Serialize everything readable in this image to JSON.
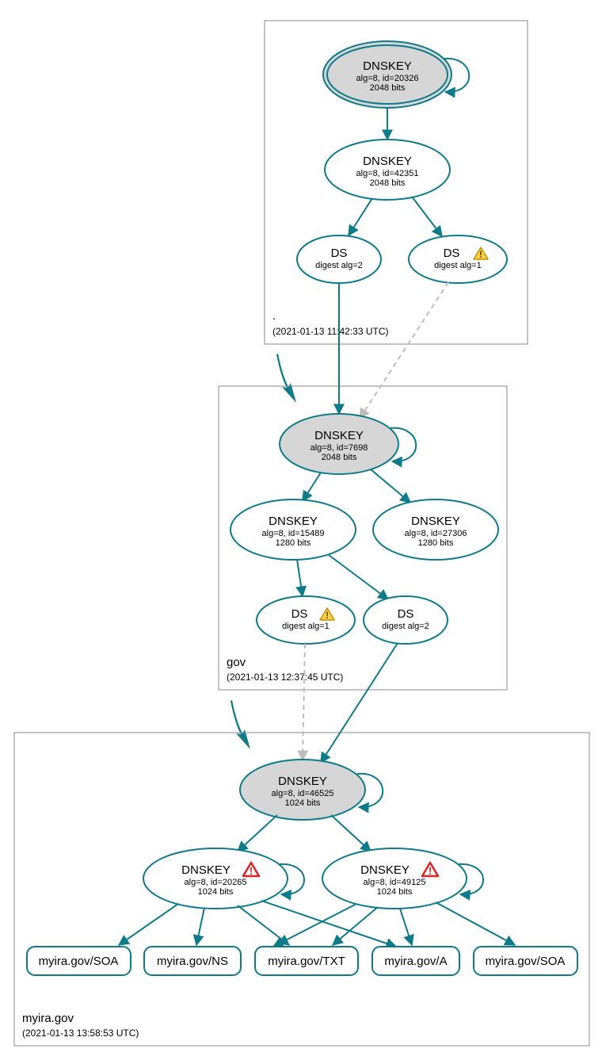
{
  "zones": {
    "root": {
      "label": ".",
      "timestamp": "(2021-01-13 11:42:33 UTC)"
    },
    "gov": {
      "label": "gov",
      "timestamp": "(2021-01-13 12:37:45 UTC)"
    },
    "myira": {
      "label": "myira.gov",
      "timestamp": "(2021-01-13 13:58:53 UTC)"
    }
  },
  "nodes": {
    "root_ksk": {
      "title": "DNSKEY",
      "line1": "alg=8, id=20326",
      "line2": "2048 bits"
    },
    "root_zsk": {
      "title": "DNSKEY",
      "line1": "alg=8, id=42351",
      "line2": "2048 bits"
    },
    "root_ds2": {
      "title": "DS",
      "line1": "digest alg=2"
    },
    "root_ds1": {
      "title": "DS",
      "line1": "digest alg=1"
    },
    "gov_ksk": {
      "title": "DNSKEY",
      "line1": "alg=8, id=7698",
      "line2": "2048 bits"
    },
    "gov_zsk1": {
      "title": "DNSKEY",
      "line1": "alg=8, id=15489",
      "line2": "1280 bits"
    },
    "gov_zsk2": {
      "title": "DNSKEY",
      "line1": "alg=8, id=27306",
      "line2": "1280 bits"
    },
    "gov_ds1": {
      "title": "DS",
      "line1": "digest alg=1"
    },
    "gov_ds2": {
      "title": "DS",
      "line1": "digest alg=2"
    },
    "my_ksk": {
      "title": "DNSKEY",
      "line1": "alg=8, id=46525",
      "line2": "1024 bits"
    },
    "my_zsk1": {
      "title": "DNSKEY",
      "line1": "alg=8, id=20265",
      "line2": "1024 bits"
    },
    "my_zsk2": {
      "title": "DNSKEY",
      "line1": "alg=8, id=49125",
      "line2": "1024 bits"
    }
  },
  "records": {
    "r1": "myira.gov/SOA",
    "r2": "myira.gov/NS",
    "r3": "myira.gov/TXT",
    "r4": "myira.gov/A",
    "r5": "myira.gov/SOA"
  }
}
